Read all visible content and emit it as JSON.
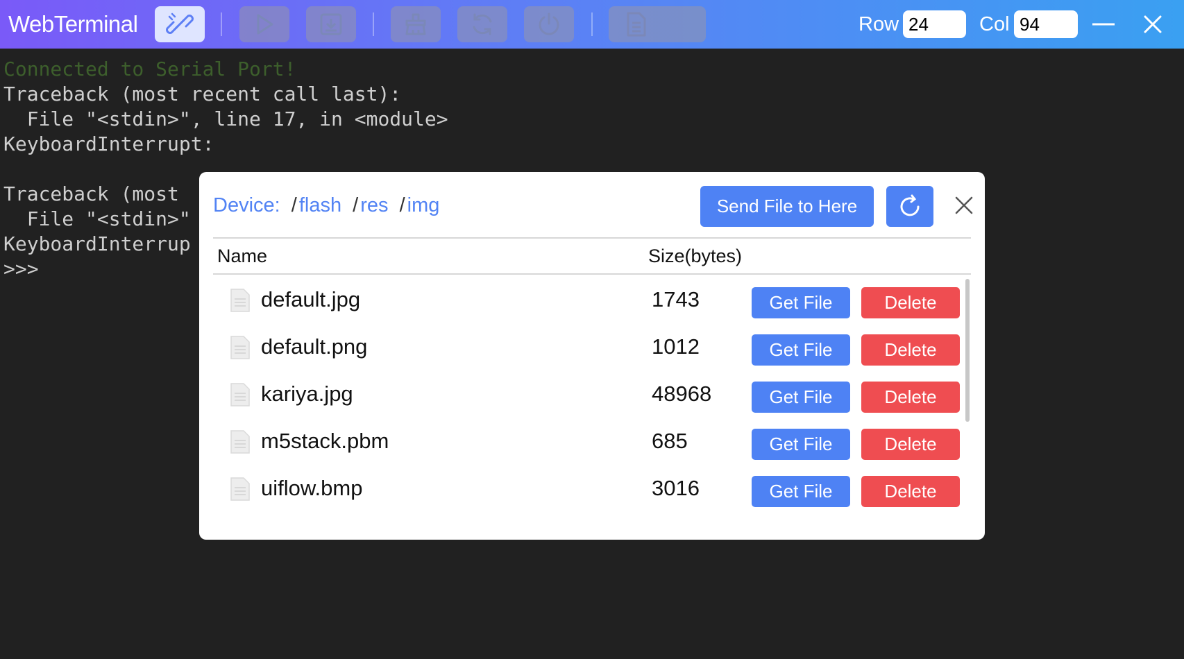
{
  "app": {
    "title": "WebTerminal",
    "row_label": "Row",
    "row_value": "24",
    "col_label": "Col",
    "col_value": "94"
  },
  "toolbar": {
    "icons": [
      "link-icon",
      "play-icon",
      "download-icon",
      "clear-icon",
      "refresh-icon",
      "power-icon",
      "file-icon"
    ]
  },
  "terminal": {
    "lines": [
      "Connected to Serial Port!",
      "Traceback (most recent call last):",
      "  File \"<stdin>\", line 17, in <module>",
      "KeyboardInterrupt:",
      "",
      "Traceback (most",
      "  File \"<stdin>\"",
      "KeyboardInterrup",
      ">>>"
    ],
    "connected_color": "#3d5f2c",
    "text_color": "#cfcfcf"
  },
  "file_dialog": {
    "device_label": "Device:",
    "path": [
      "flash",
      "res",
      "img"
    ],
    "path_sep": "/",
    "send_label": "Send File to Here",
    "headers": {
      "name": "Name",
      "size": "Size(bytes)"
    },
    "get_label": "Get File",
    "delete_label": "Delete",
    "files": [
      {
        "name": "default.jpg",
        "size": "1743"
      },
      {
        "name": "default.png",
        "size": "1012"
      },
      {
        "name": "kariya.jpg",
        "size": "48968"
      },
      {
        "name": "m5stack.pbm",
        "size": "685"
      },
      {
        "name": "uiflow.bmp",
        "size": "3016"
      }
    ]
  },
  "colors": {
    "primary": "#4e82f4",
    "danger": "#ef4d51",
    "link": "#5283f4"
  }
}
